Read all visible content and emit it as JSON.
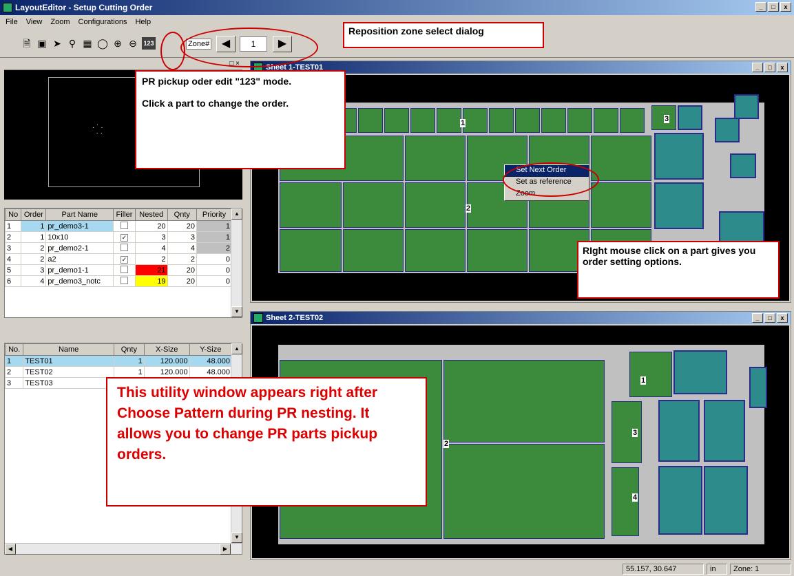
{
  "window": {
    "title": "LayoutEditor - Setup Cutting Order",
    "min": "_",
    "max": " ",
    "close": "x"
  },
  "menu": [
    "File",
    "View",
    "Zoom",
    "Configurations",
    "Help"
  ],
  "toolbar": {
    "zone_label": "Zone#",
    "zone_value": "1",
    "order_button": "123"
  },
  "parts_table": {
    "headers": [
      "No",
      "Order",
      "Part Name",
      "Filler",
      "Nested",
      "Qnty",
      "Priority"
    ],
    "rows": [
      {
        "no": "1",
        "order": "1",
        "name": "pr_demo3-1",
        "filler": false,
        "nested": "20",
        "qnty": "20",
        "priority": "1"
      },
      {
        "no": "2",
        "order": "1",
        "name": "10x10",
        "filler": true,
        "nested": "3",
        "qnty": "3",
        "priority": "1"
      },
      {
        "no": "3",
        "order": "2",
        "name": "pr_demo2-1",
        "filler": false,
        "nested": "4",
        "qnty": "4",
        "priority": "2"
      },
      {
        "no": "4",
        "order": "2",
        "name": "a2",
        "filler": true,
        "nested": "2",
        "qnty": "2",
        "priority": "0"
      },
      {
        "no": "5",
        "order": "3",
        "name": "pr_demo1-1",
        "filler": false,
        "nested": "21",
        "qnty": "20",
        "priority": "0"
      },
      {
        "no": "6",
        "order": "4",
        "name": "pr_demo3_notc",
        "filler": false,
        "nested": "19",
        "qnty": "20",
        "priority": "0"
      }
    ]
  },
  "sheets_table": {
    "headers": [
      "No.",
      "Name",
      "Qnty",
      "X-Size",
      "Y-Size"
    ],
    "rows": [
      {
        "no": "1",
        "name": "TEST01",
        "qnty": "1",
        "x": "120.000",
        "y": "48.000"
      },
      {
        "no": "2",
        "name": "TEST02",
        "qnty": "1",
        "x": "120.000",
        "y": "48.000"
      },
      {
        "no": "3",
        "name": "TEST03",
        "qnty": "",
        "x": "",
        "y": ""
      }
    ]
  },
  "sheet1": {
    "title": "Sheet 1-TEST01",
    "markers": [
      "1",
      "2",
      "3"
    ]
  },
  "sheet2": {
    "title": "Sheet 2-TEST02",
    "markers": [
      "1",
      "2",
      "3",
      "4"
    ]
  },
  "context_menu": [
    "Set Next Order",
    "Set as reference",
    "Zoom"
  ],
  "callouts": {
    "zone": "Reposition zone select dialog",
    "pr_line1": "PR pickup oder edit \"123\" mode.",
    "pr_line2": "Click a part to change the order.",
    "right_click": "RIght mouse click on a part gives you order setting options.",
    "utility": "This utility window appears right after Choose Pattern during PR nesting.  It allows you to change PR parts pickup orders."
  },
  "status": {
    "coords": "55.157, 30.647",
    "unit": "in",
    "zone": "Zone: 1"
  },
  "colors": {
    "selected_row": "#a6d8f0",
    "nested_over": "#ff0000",
    "nested_under": "#ffff00",
    "callout": "#cc0000"
  }
}
